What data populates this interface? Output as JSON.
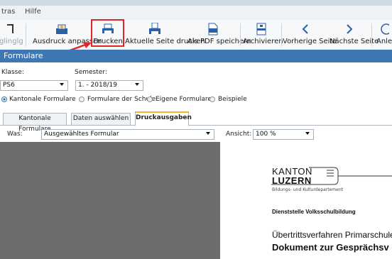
{
  "menu": {
    "items": [
      "tras",
      "Hilfe"
    ]
  },
  "toolbar": {
    "buttons": [
      {
        "label": "glinglg",
        "icon": "partial-icon"
      },
      {
        "label": "Ausdruck anpassen",
        "icon": "customize-print-icon"
      },
      {
        "label": "Drucken",
        "icon": "printer-icon"
      },
      {
        "label": "Aktuelle Seite drucken",
        "icon": "print-page-icon"
      },
      {
        "label": "Als PDF speichern",
        "icon": "pdf-icon"
      },
      {
        "label": "Archivieren",
        "icon": "archive-icon"
      },
      {
        "label": "Vorherige Seite",
        "icon": "chevron-left-icon"
      },
      {
        "label": "Nächste Seite",
        "icon": "chevron-right-icon"
      },
      {
        "label": "Anle",
        "icon": "partial-icon"
      }
    ],
    "highlight_color": "#e0242a"
  },
  "section": {
    "title": "Formulare"
  },
  "filters": {
    "klasse_label": "Klasse:",
    "klasse_value": "PS6",
    "semester_label": "Semester:",
    "semester_value": "1. - 2018/19"
  },
  "radios": [
    {
      "label": "Kantonale Formulare",
      "selected": true
    },
    {
      "label": "Formulare der Schule",
      "selected": false
    },
    {
      "label": "Eigene Formulare",
      "selected": false
    },
    {
      "label": "Beispiele",
      "selected": false
    }
  ],
  "tabs": [
    {
      "label": "Kantonale Formulare",
      "active": false
    },
    {
      "label": "Daten auswählen",
      "active": false
    },
    {
      "label": "Druckausgaben",
      "active": true
    }
  ],
  "was": {
    "label": "Was:",
    "value": "Ausgewähltes Formular"
  },
  "ansicht": {
    "label": "Ansicht:",
    "value": "100 %"
  },
  "document": {
    "logo_line1": "KANTON",
    "logo_line2": "LUZERN",
    "logo_sub": "Bildungs- und Kulturdepartement",
    "dept": "Dienststelle Volksschulbildung",
    "line1": "Übertrittsverfahren Primarschule -",
    "line2": "Dokument zur Gesprächsv"
  }
}
